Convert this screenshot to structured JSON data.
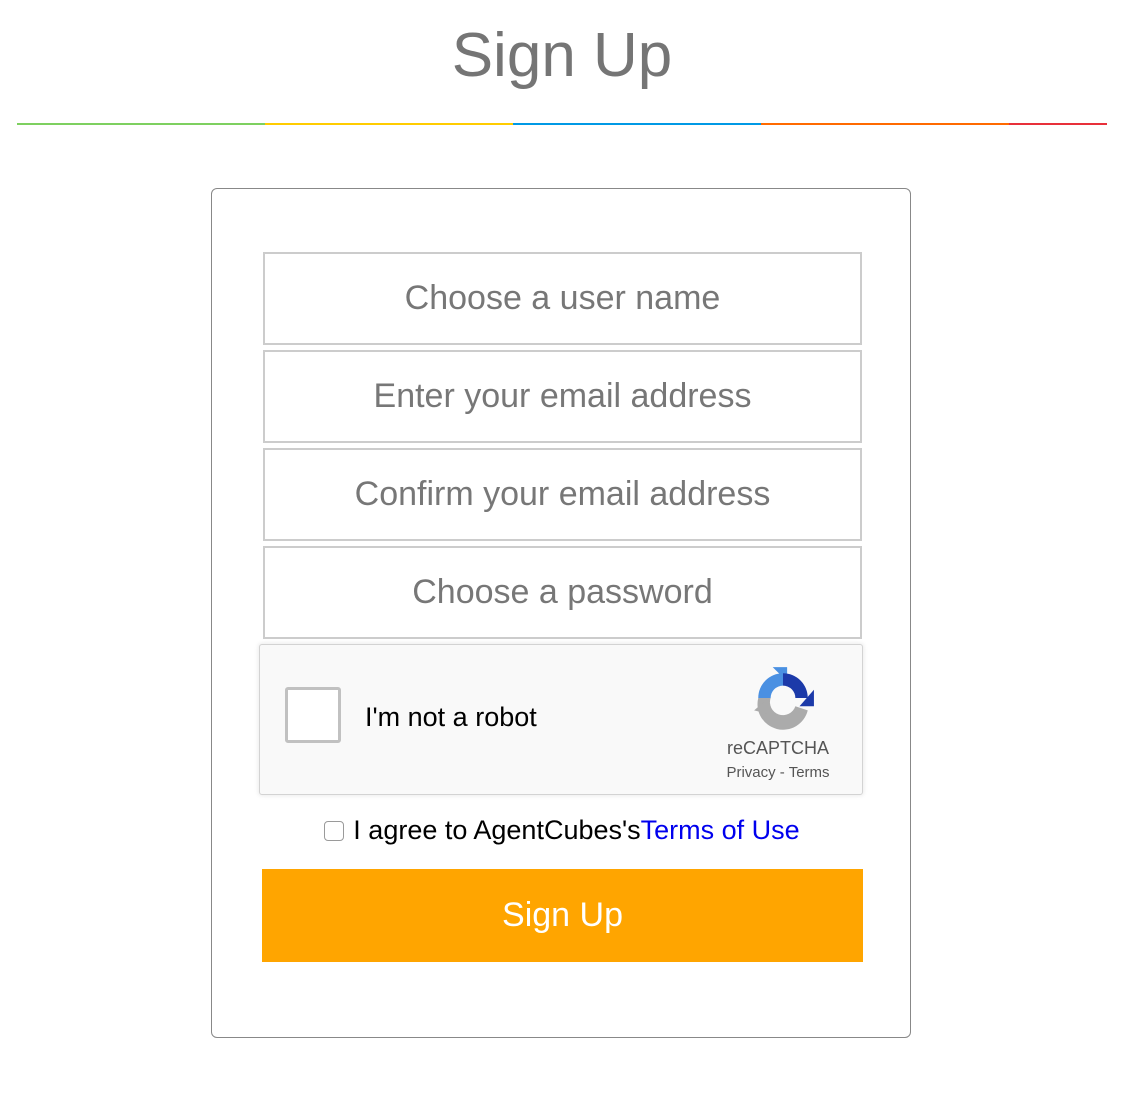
{
  "header": {
    "title": "Sign Up",
    "rule_colors": [
      "#7ed060",
      "#ffcc00",
      "#0099e5",
      "#ff6a00",
      "#e8303a"
    ]
  },
  "form": {
    "fields": [
      {
        "name": "username",
        "placeholder": "Choose a user name",
        "value": ""
      },
      {
        "name": "email",
        "placeholder": "Enter your email address",
        "value": ""
      },
      {
        "name": "email_confirm",
        "placeholder": "Confirm your email address",
        "value": ""
      },
      {
        "name": "password",
        "placeholder": "Choose a password",
        "value": ""
      }
    ],
    "recaptcha": {
      "label": "I'm not a robot",
      "brand": "reCAPTCHA",
      "privacy_label": "Privacy",
      "separator": " - ",
      "terms_label": "Terms",
      "checked": false
    },
    "agree": {
      "text": "I agree to AgentCubes's",
      "link_label": "Terms of Use",
      "checked": false
    },
    "submit_label": "Sign Up",
    "submit_color": "#ffa500"
  }
}
